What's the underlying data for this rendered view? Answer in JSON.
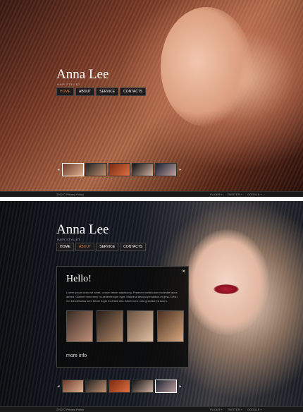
{
  "site": {
    "name": "Anna Lee",
    "tagline": "HAIR STYLIST"
  },
  "nav": [
    "HOME",
    "ABOUT",
    "SERVICE",
    "CONTACTS"
  ],
  "panel1": {
    "active_nav_index": 0
  },
  "panel2": {
    "active_nav_index": 1
  },
  "footer": {
    "copyright": "2012 © Privacy Policy",
    "social": [
      "FLICKR +",
      "TWITTER +",
      "GOOGLE +"
    ]
  },
  "modal": {
    "title": "Hello!",
    "text": "Lorem ipsum dolor sit amet, conum tetuer adipiscing. Praesent vestibulum molestie lacus aenea. Gfamet nonummy hs pellentesque eget. Mauresit aeatpa penalibus et gma. Geon mo stenathullus sem tetuer fuget molestie ulla. Morb nunc odio gravidat ea scum.",
    "more": "more info",
    "close": "×"
  },
  "colors": {
    "accent": "#d97a3f",
    "bar": "#1a1a1a"
  }
}
